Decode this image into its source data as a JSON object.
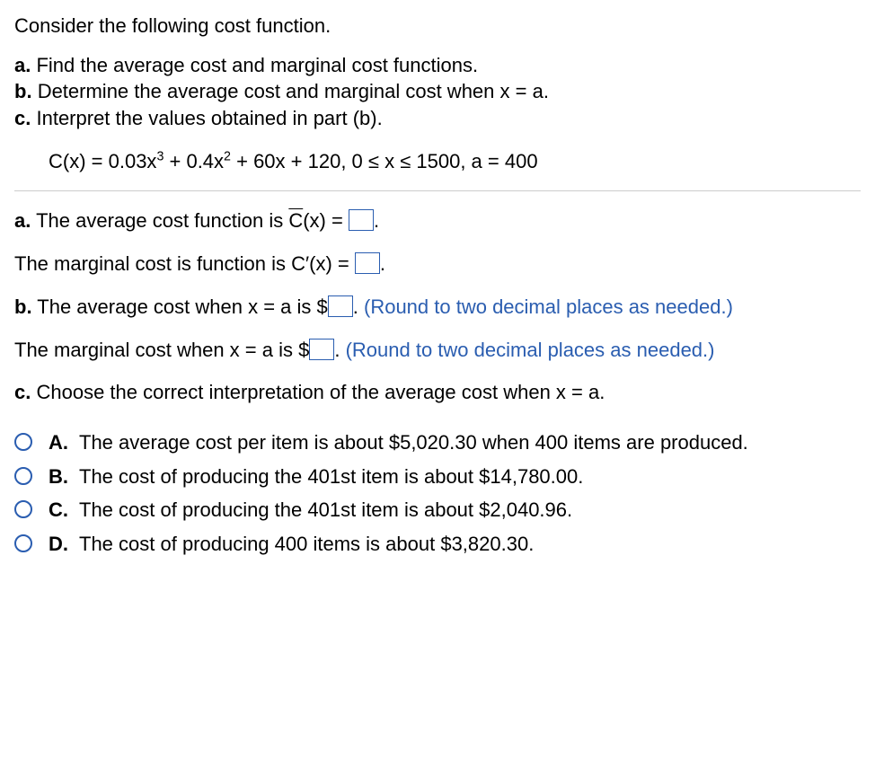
{
  "intro": "Consider the following cost function.",
  "parts": {
    "a": {
      "label": "a.",
      "text": "Find the average cost and marginal cost functions."
    },
    "b": {
      "label": "b.",
      "text": "Determine the average cost and marginal cost when x = a."
    },
    "c": {
      "label": "c.",
      "text": "Interpret the values obtained in part (b)."
    }
  },
  "equation": {
    "pre": "C(x) = 0.03x",
    "sup1": "3",
    "mid1": " + 0.4x",
    "sup2": "2",
    "tail": " + 60x + 120, 0 ≤ x ≤ 1500, a = 400"
  },
  "qa": {
    "label_a": "a.",
    "avg_pre": "The average cost function is ",
    "avg_fn": "C",
    "avg_post": "(x) = ",
    "marg_pre": "The marginal cost is function is C′(x) = ",
    "label_b": "b.",
    "avg_at_a_pre": "The average cost when x = a is $",
    "hint_round": "(Round to two decimal places as needed.)",
    "marg_at_a_pre": "The marginal cost when x = a is $",
    "label_c": "c.",
    "interpret": "Choose the correct interpretation of the average cost when x = a."
  },
  "options": [
    {
      "label": "A.",
      "text": "The average cost per item is about $5,020.30 when 400 items are produced."
    },
    {
      "label": "B.",
      "text": "The cost of producing the 401st item is about $14,780.00."
    },
    {
      "label": "C.",
      "text": "The cost of producing the 401st item is about $2,040.96."
    },
    {
      "label": "D.",
      "text": "The cost of producing 400 items is about $3,820.30."
    }
  ],
  "period": "."
}
